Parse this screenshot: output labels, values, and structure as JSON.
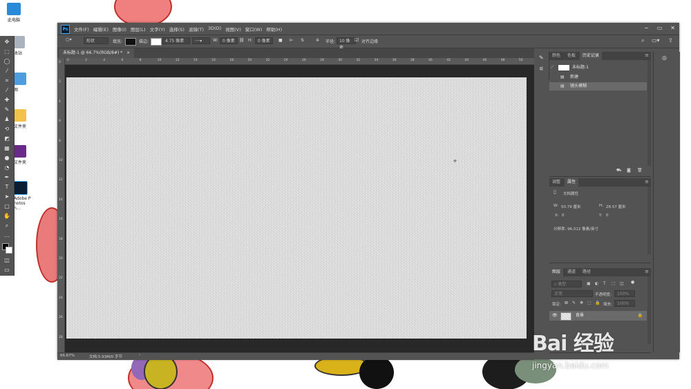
{
  "desktop": {
    "icons": [
      {
        "label": "此电脑"
      },
      {
        "label": "文件夹"
      },
      {
        "label": "文件夹"
      },
      {
        "label": "Adobe Photosh..."
      }
    ],
    "partial_labels": [
      "收站",
      "图"
    ]
  },
  "app": {
    "logo": "Ps",
    "menus": [
      "文件(F)",
      "编辑(E)",
      "图像(I)",
      "图层(L)",
      "文字(Y)",
      "选择(S)",
      "滤镜(T)",
      "3D(D)",
      "视图(V)",
      "窗口(W)",
      "帮助(H)"
    ],
    "window_controls": {
      "minimize": "−",
      "maximize": "▭",
      "close": "✕"
    }
  },
  "options": {
    "mode": "形状",
    "fill_label": "填充:",
    "fill_color": "#111111",
    "stroke_label": "描边:",
    "stroke_size": "4.75 像素",
    "w_label": "W:",
    "w_value": "0 像素",
    "h_label": "H:",
    "h_value": "0 像素",
    "radius_label": "半径:",
    "radius_value": "10 像素",
    "align_edges_label": "对齐边缘",
    "align_edges_checked": true
  },
  "document": {
    "tab_title": "未标题-1 @ 66.7%(RGB/8#) *",
    "close": "×",
    "ruler_marks_h": [
      "0",
      "2",
      "4",
      "6",
      "8",
      "10",
      "12",
      "14",
      "16",
      "18",
      "20",
      "22",
      "24",
      "26",
      "28",
      "30",
      "32",
      "34",
      "36",
      "38",
      "40",
      "42",
      "44",
      "46",
      "48",
      "50"
    ],
    "ruler_marks_v": [
      "0",
      "2",
      "4",
      "6",
      "8",
      "10",
      "12",
      "14",
      "16",
      "18",
      "20",
      "22",
      "24",
      "26",
      "28"
    ]
  },
  "status": {
    "zoom": "66.67%",
    "doc_info": "文档:5.93M/0 字节"
  },
  "panels": {
    "top": {
      "tabs": [
        "颜色",
        "色板",
        "历史记录"
      ],
      "active": "历史记录",
      "snapshot": "未标题-1",
      "history": [
        "新建",
        "镜头模糊"
      ]
    },
    "properties": {
      "tabs": [
        "调整",
        "属性"
      ],
      "active": "属性",
      "title": "文档属性",
      "w_label": "W:",
      "w_value": "50.79 厘米",
      "h_label": "H:",
      "h_value": "28.57 厘米",
      "x_label": "X:",
      "x_value": "0",
      "y_label": "Y:",
      "y_value": "0",
      "resolution": "分辨率: 96.012 像素/英寸"
    },
    "layers": {
      "tabs": [
        "图层",
        "通道",
        "路径"
      ],
      "active": "图层",
      "filter": "类型",
      "blend_mode": "正常",
      "opacity_label": "不透明度:",
      "opacity_value": "100%",
      "lock_label": "锁定:",
      "fill_label": "填充:",
      "fill_value": "100%",
      "layer_name": "背景"
    }
  },
  "watermark": {
    "brand": "Bai 经验",
    "url": "jingyan.baidu.com"
  }
}
